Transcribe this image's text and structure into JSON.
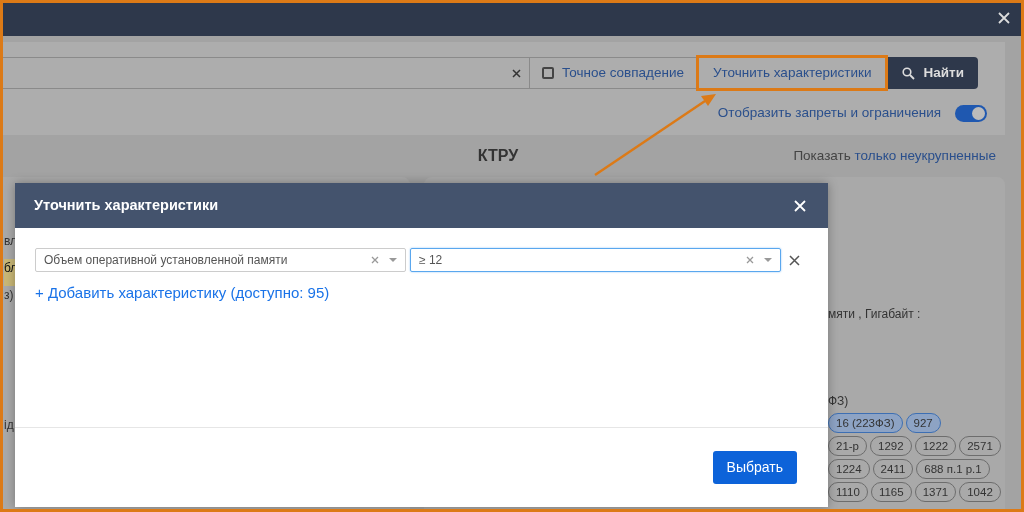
{
  "search": {
    "exact_match": {
      "label": "Точное совпадение",
      "checked": false
    },
    "refine_button": {
      "label": "Уточнить характеристики",
      "highlighted": true
    },
    "find_button": "Найти",
    "restrictions_toggle": {
      "label": "Отобразить запреты и ограничения",
      "on": true
    }
  },
  "section": {
    "title": "КТРУ",
    "show_prefix": "Показать",
    "show_link": "только неукрупненные"
  },
  "left_fragments": [
    {
      "text": "вл",
      "highlighted": false
    },
    {
      "text": "бл",
      "highlighted": true
    },
    {
      "text": "з)",
      "highlighted": false
    },
    {
      "text": "ід",
      "highlighted": false
    }
  ],
  "right_panel": {
    "text": "мяти , Гигабайт :",
    "law_text": "ФЗ)",
    "chip_rows": [
      [
        {
          "label": "16 (223ФЗ)",
          "selected": true
        },
        {
          "label": "927",
          "selected": true
        }
      ],
      [
        {
          "label": "21-р",
          "selected": false
        },
        {
          "label": "1292",
          "selected": false
        },
        {
          "label": "1222",
          "selected": false
        },
        {
          "label": "2571",
          "selected": false
        }
      ],
      [
        {
          "label": "1224",
          "selected": false
        },
        {
          "label": "2411",
          "selected": false
        },
        {
          "label": "688 п.1 р.1",
          "selected": false
        }
      ],
      [
        {
          "label": "1110",
          "selected": false
        },
        {
          "label": "1165",
          "selected": false
        },
        {
          "label": "1371",
          "selected": false
        },
        {
          "label": "1042",
          "selected": false
        }
      ]
    ]
  },
  "modal": {
    "title": "Уточнить характеристики",
    "filters": [
      {
        "characteristic": "Объем оперативной установленной памяти",
        "value": "≥ 12"
      }
    ],
    "add_link": "+ Добавить характеристику (доступно: 95)",
    "submit": "Выбрать"
  }
}
